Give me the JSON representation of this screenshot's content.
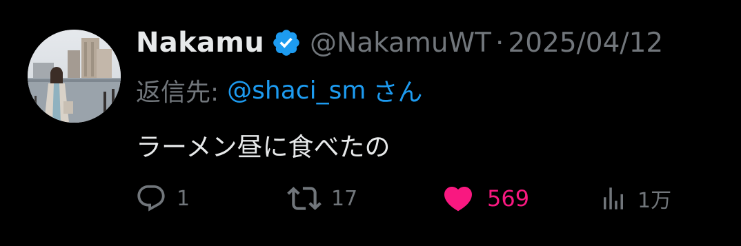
{
  "tweet": {
    "author": {
      "display_name": "Nakamu",
      "handle": "@NakamuWT",
      "verified": true,
      "verified_icon": "verified-badge-icon"
    },
    "separator": "·",
    "date": "2025/04/12",
    "reply_to": {
      "prefix": "返信先:",
      "user": "@shaci_sm",
      "suffix": "さん"
    },
    "text": "ラーメン昼に食べたの",
    "actions": {
      "reply": {
        "icon": "reply-icon",
        "count": "1"
      },
      "retweet": {
        "icon": "retweet-icon",
        "count": "17"
      },
      "like": {
        "icon": "heart-icon",
        "count": "569",
        "active": true
      },
      "views": {
        "icon": "views-icon",
        "count": "1万"
      }
    }
  },
  "colors": {
    "background": "#000000",
    "primary_text": "#e7e9ea",
    "secondary_text": "#71767b",
    "link": "#1d9bf0",
    "like_active": "#f91880",
    "verified": "#1d9bf0"
  }
}
